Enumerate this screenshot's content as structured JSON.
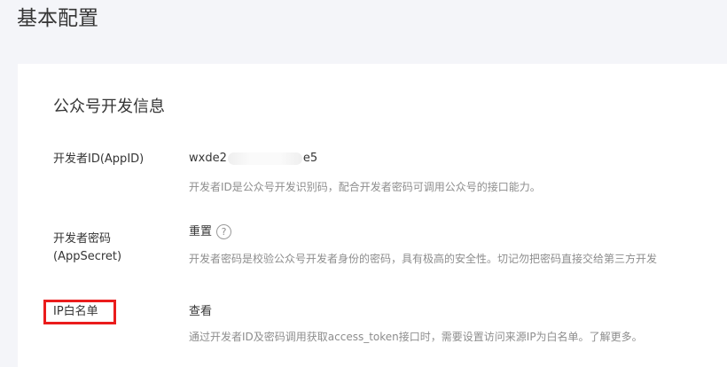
{
  "page": {
    "title": "基本配置"
  },
  "section": {
    "title": "公众号开发信息"
  },
  "rows": {
    "appid": {
      "label": "开发者ID(AppID)",
      "value_prefix": "wxde2",
      "value_suffix": "e5",
      "description": "开发者ID是公众号开发识别码，配合开发者密码可调用公众号的接口能力。"
    },
    "secret": {
      "label_line1": "开发者密码",
      "label_line2": "(AppSecret)",
      "action": "重置",
      "help_icon": "?",
      "description": "开发者密码是校验公众号开发者身份的密码，具有极高的安全性。切记勿把密码直接交给第三方开发"
    },
    "ip_whitelist": {
      "label": "IP白名单",
      "action": "查看",
      "description_prefix": "通过开发者ID及密码调用获取access_token接口时，需要设置访问来源IP为白名单。",
      "description_link": "了解更多",
      "description_suffix": "。"
    }
  },
  "colors": {
    "highlight": "#ea1c1c",
    "background": "#f4f5f9",
    "card": "#ffffff",
    "text": "#353535",
    "muted": "#8d8d8d"
  }
}
